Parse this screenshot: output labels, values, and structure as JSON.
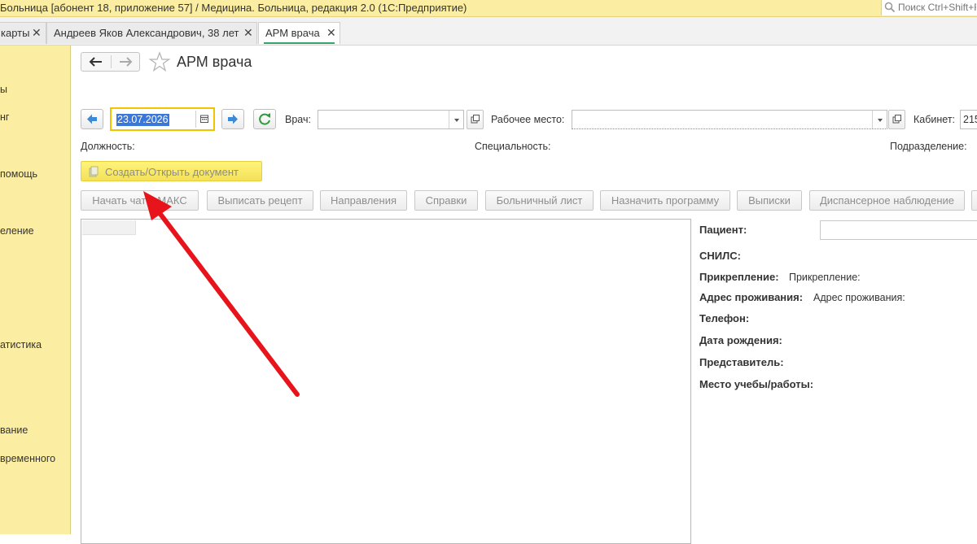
{
  "window": {
    "title": "Больница [абонент 18, приложение 57] / Медицина. Больница, редакция 2.0  (1С:Предприятие)",
    "search_placeholder": "Поиск Ctrl+Shift+F"
  },
  "tabs": [
    {
      "label": "карты",
      "active": false
    },
    {
      "label": "Андреев Яков Александрович, 38 лет",
      "active": false
    },
    {
      "label": "АРМ врача",
      "active": true
    }
  ],
  "sidebar": {
    "items": [
      "ы",
      "нг",
      "помощь",
      "еление",
      "атистика",
      "вание",
      "временного"
    ]
  },
  "page": {
    "title": "АРМ врача"
  },
  "filters": {
    "date_value": "23.07.2026",
    "doctor_label": "Врач:",
    "doctor_value": "",
    "workplace_label": "Рабочее место:",
    "workplace_value": "",
    "cabinet_label": "Кабинет:",
    "cabinet_value": "215",
    "position_label": "Должность:",
    "specialty_label": "Специальность:",
    "department_label": "Подразделение:"
  },
  "document_button": "Создать/Открыть документ",
  "actions": [
    "Начать чат в МАКС",
    "Выписать рецепт",
    "Направления",
    "Справки",
    "Больничный лист",
    "Назначить программу",
    "Выписки",
    "Диспансерное наблюдение"
  ],
  "patient_info": {
    "patient_label": "Пациент:",
    "patient_value": "",
    "snils_label": "СНИЛС:",
    "attachment_label": "Прикрепление:",
    "attachment_value": "Прикрепление:",
    "address_label": "Адрес проживания:",
    "address_value": "Адрес проживания:",
    "phone_label": "Телефон:",
    "birth_label": "Дата рождения:",
    "representative_label": "Представитель:",
    "work_label": "Место учебы/работы:"
  },
  "colors": {
    "accent_yellow": "#fbeda2",
    "button_yellow": "#fff37a",
    "tab_underline": "#3aa36a",
    "annotation_arrow": "#e8141b",
    "nav_arrow": "#3a8ad8",
    "refresh": "#2e9a3c"
  },
  "icons": [
    "search-icon",
    "close-icon",
    "back-arrow-icon",
    "forward-arrow-icon",
    "star-icon",
    "calendar-icon",
    "refresh-icon",
    "dropdown-icon",
    "open-icon",
    "document-icon"
  ]
}
